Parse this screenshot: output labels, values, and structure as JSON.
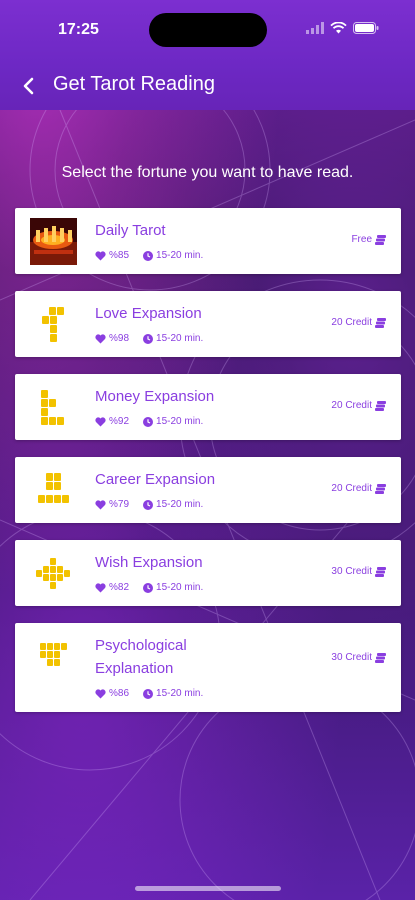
{
  "status_bar": {
    "time": "17:25"
  },
  "header": {
    "title": "Get Tarot Reading"
  },
  "subtitle": "Select the fortune you want to have read.",
  "colors": {
    "accent": "#8a3ee0",
    "header": "#6d28c4",
    "icon_yellow": "#f2c200"
  },
  "readings": [
    {
      "title": "Daily Tarot",
      "rating": "%85",
      "duration": "15-20 min.",
      "price": "Free",
      "icon": "daily-tarot-image"
    },
    {
      "title": "Love Expansion",
      "rating": "%98",
      "duration": "15-20 min.",
      "price": "20 Credit",
      "icon": "love-spread-icon"
    },
    {
      "title": "Money Expansion",
      "rating": "%92",
      "duration": "15-20 min.",
      "price": "20 Credit",
      "icon": "money-spread-icon"
    },
    {
      "title": "Career Expansion",
      "rating": "%79",
      "duration": "15-20 min.",
      "price": "20 Credit",
      "icon": "career-spread-icon"
    },
    {
      "title": "Wish Expansion",
      "rating": "%82",
      "duration": "15-20 min.",
      "price": "30 Credit",
      "icon": "wish-spread-icon"
    },
    {
      "title": "Psychological Explanation",
      "rating": "%86",
      "duration": "15-20 min.",
      "price": "30 Credit",
      "icon": "psychological-spread-icon"
    }
  ]
}
